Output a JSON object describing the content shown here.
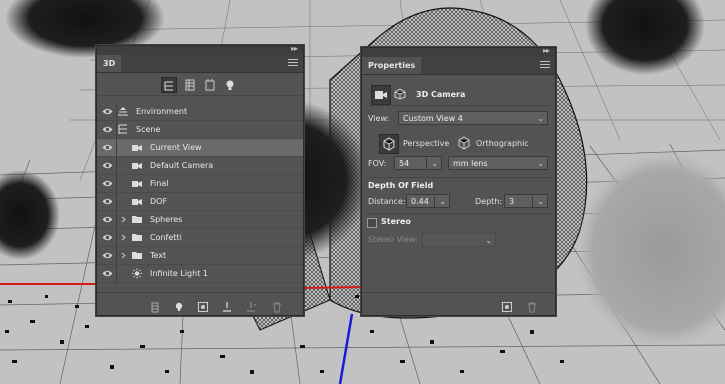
{
  "panel_3d": {
    "title": "3D",
    "layers": [
      {
        "label": "Environment",
        "icon": "environment-icon",
        "indent": 0,
        "expandable": false,
        "selected": false
      },
      {
        "label": "Scene",
        "icon": "scene-icon",
        "indent": 0,
        "expandable": false,
        "selected": false
      },
      {
        "label": "Current View",
        "icon": "camera-icon",
        "indent": 1,
        "expandable": false,
        "selected": true
      },
      {
        "label": "Default Camera",
        "icon": "camera-icon",
        "indent": 1,
        "expandable": false,
        "selected": false
      },
      {
        "label": "Final",
        "icon": "camera-icon",
        "indent": 1,
        "expandable": false,
        "selected": false
      },
      {
        "label": "DOF",
        "icon": "camera-icon",
        "indent": 1,
        "expandable": false,
        "selected": false
      },
      {
        "label": "Spheres",
        "icon": "folder-icon",
        "indent": 1,
        "expandable": true,
        "selected": false
      },
      {
        "label": "Confetti",
        "icon": "folder-icon",
        "indent": 1,
        "expandable": true,
        "selected": false
      },
      {
        "label": "Text",
        "icon": "folder-icon",
        "indent": 1,
        "expandable": true,
        "selected": false
      },
      {
        "label": "Infinite Light 1",
        "icon": "infinite-light-icon",
        "indent": 1,
        "expandable": false,
        "selected": false
      }
    ]
  },
  "properties": {
    "title": "Properties",
    "header": "3D Camera",
    "view_label": "View:",
    "view_value": "Custom View 4",
    "perspective_label": "Perspective",
    "orthographic_label": "Orthographic",
    "fov_label": "FOV:",
    "fov_value": "54",
    "lens_value": "mm lens",
    "dof_title": "Depth Of Field",
    "distance_label": "Distance:",
    "distance_value": "0.44",
    "depth_label": "Depth:",
    "depth_value": "3",
    "stereo_label": "Stereo",
    "stereo_view_label": "Stereo View:",
    "stereo_view_value": ""
  }
}
